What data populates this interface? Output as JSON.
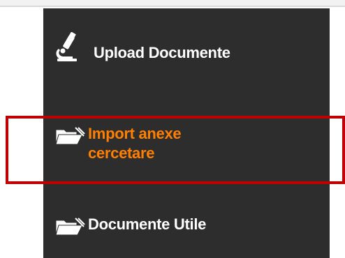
{
  "menu": {
    "items": [
      {
        "label": "Upload Documente",
        "icon": "microscope-icon",
        "active": false
      },
      {
        "label": "Import anexe cercetare",
        "icon": "folder-open-icon",
        "active": true
      },
      {
        "label": "Documente Utile",
        "icon": "folder-open-icon",
        "active": false
      }
    ]
  },
  "colors": {
    "sidebar_bg": "#2d2d2d",
    "item_text": "#ffffff",
    "active_text": "#ff7f00",
    "highlight_border": "#c00000"
  }
}
